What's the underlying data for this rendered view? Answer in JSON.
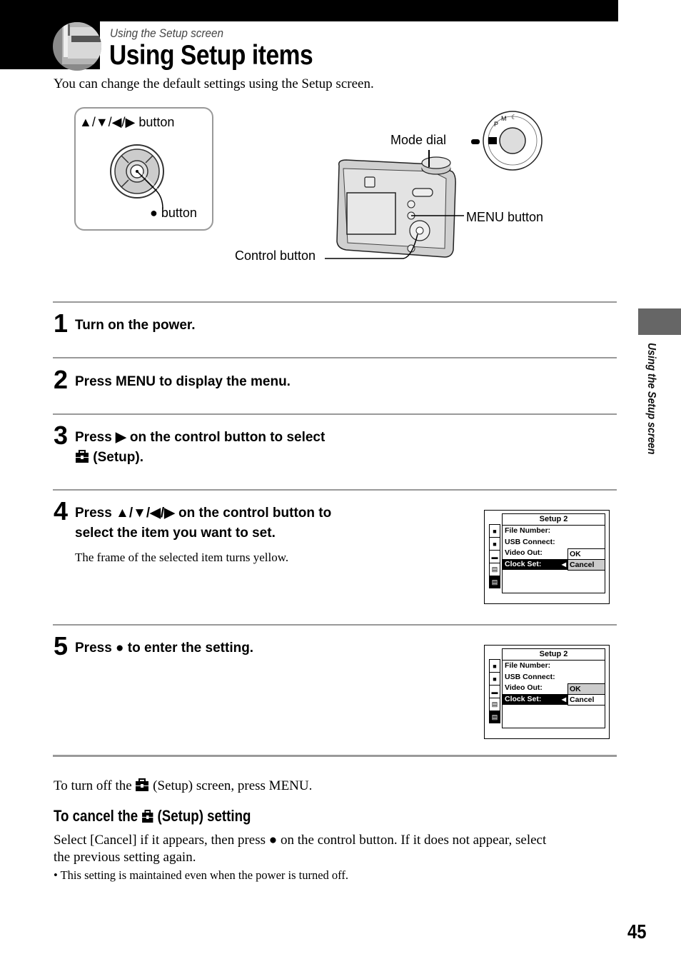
{
  "header": {
    "section": "Using the Setup screen",
    "title": "Using Setup items",
    "intro": "You can change the default settings using the Setup screen."
  },
  "diagram": {
    "arrows_button_label": "▲/▼/◀/▶ button",
    "center_button_glyph": "●",
    "center_button_label": "button",
    "mode_dial_label": "Mode dial",
    "menu_button_label": "MENU button",
    "control_button_label": "Control button"
  },
  "steps": [
    {
      "num": "1",
      "text": "Turn on the power."
    },
    {
      "num": "2",
      "text": "Press MENU to display the menu."
    },
    {
      "num": "3",
      "line1": "Press ▶ on the control button to select",
      "line2": "(Setup)."
    },
    {
      "num": "4",
      "line1": "Press ▲/▼/◀/▶ on the control button to",
      "line2": "select the item you want to set.",
      "note": "The frame of the selected item turns yellow."
    },
    {
      "num": "5",
      "text": "Press ● to enter the setting."
    }
  ],
  "lcd_screens": [
    {
      "title": "Setup 2",
      "side_icons": [
        "camera-1-icon",
        "camera-2-icon",
        "memory-stick-icon",
        "setup-1-icon",
        "setup-2-icon"
      ],
      "side_labels": [
        "1",
        "2",
        "",
        "1",
        "2"
      ],
      "rows": [
        "File Number:",
        "USB Connect:",
        "Video Out:",
        "Clock Set:"
      ],
      "selected_row": "Clock Set:",
      "options": [
        "OK",
        "Cancel"
      ],
      "highlighted_option": "Cancel"
    },
    {
      "title": "Setup 2",
      "side_icons": [
        "camera-1-icon",
        "camera-2-icon",
        "memory-stick-icon",
        "setup-1-icon",
        "setup-2-icon"
      ],
      "side_labels": [
        "1",
        "2",
        "",
        "1",
        "2"
      ],
      "rows": [
        "File Number:",
        "USB Connect:",
        "Video Out:",
        "Clock Set:"
      ],
      "selected_row": "Clock Set:",
      "options": [
        "OK",
        "Cancel"
      ],
      "highlighted_option": "OK"
    }
  ],
  "footer": {
    "turn_off_pre": "To turn off the",
    "turn_off_post": "(Setup) screen, press MENU.",
    "cancel_heading_pre": "To cancel the",
    "cancel_heading_post": "(Setup) setting",
    "cancel_body_line1": "Select [Cancel] if it appears, then press ● on the control button. If it does not appear, select",
    "cancel_body_line2": "the previous setting again.",
    "bullet": "• This setting is maintained even when the power is turned off."
  },
  "side_tab_label": "Using the Setup screen",
  "page_number": "45"
}
